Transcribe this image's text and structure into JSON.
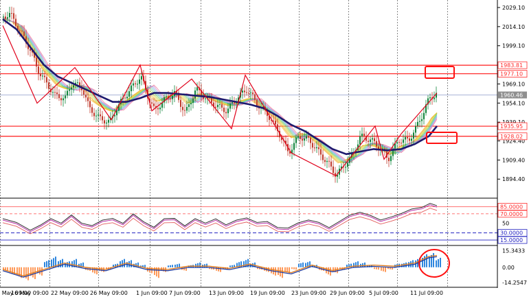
{
  "main_axis": {
    "min": 1880,
    "max": 2035,
    "ticks": [
      "2029.10",
      "2014.10",
      "1999.10",
      "1969.10",
      "1954.10",
      "1939.10",
      "1924.40",
      "1909.40",
      "1894.40"
    ],
    "tick_values": [
      2029.1,
      2014.1,
      1999.1,
      1969.1,
      1954.1,
      1939.1,
      1924.4,
      1909.4,
      1894.4
    ]
  },
  "price_labels": [
    {
      "text": "1983.81",
      "value": 1983.81,
      "color": "#ff2a2a"
    },
    {
      "text": "1977.10",
      "value": 1977.1,
      "color": "#ff2a2a"
    },
    {
      "text": "1960.46",
      "value": 1960.46,
      "color": "#ffffff",
      "bg": "#8f8f8f"
    },
    {
      "text": "1935.95",
      "value": 1935.95,
      "color": "#ff2a2a"
    },
    {
      "text": "1928.02",
      "value": 1928.02,
      "color": "#ff2a2a"
    }
  ],
  "levels": [
    1983.81,
    1977.1,
    1935.95,
    1928.02
  ],
  "current_price": 1960.46,
  "osc_axis": {
    "min": 5,
    "max": 100,
    "ticks": [
      {
        "text": "85.0000",
        "value": 85,
        "style": "red"
      },
      {
        "text": "70.0000",
        "value": 70,
        "style": "red"
      },
      {
        "text": "50",
        "value": 50,
        "style": "plain"
      },
      {
        "text": "30.0000",
        "value": 30,
        "style": "blue"
      },
      {
        "text": "15.0000",
        "value": 15,
        "style": "blue"
      }
    ]
  },
  "macd_axis": {
    "min": -18,
    "max": 19,
    "ticks": [
      {
        "text": "15.3433",
        "value": 15.3433
      },
      {
        "text": "0.00",
        "value": 0
      },
      {
        "text": "-14.2547",
        "value": -14.2547
      }
    ]
  },
  "dates": [
    "10 May 09:00",
    "16 May 09:00",
    "22 May 09:00",
    "26 May 09:00",
    "1 Jun 09:00",
    "7 Jun 09:00",
    "13 Jun 09:00",
    "19 Jun 09:00",
    "23 Jun 09:00",
    "29 Jun 09:00",
    "5 Jul 09:00",
    "11 Jul 09:00"
  ],
  "price_path": [
    [
      0,
      2022
    ],
    [
      10,
      2024
    ],
    [
      25,
      2010
    ],
    [
      40,
      1995
    ],
    [
      50,
      1980
    ],
    [
      65,
      1968
    ],
    [
      75,
      1960
    ],
    [
      90,
      1958
    ],
    [
      100,
      1970
    ],
    [
      115,
      1966
    ],
    [
      125,
      1950
    ],
    [
      140,
      1942
    ],
    [
      155,
      1939
    ],
    [
      165,
      1950
    ],
    [
      175,
      1958
    ],
    [
      185,
      1965
    ],
    [
      200,
      1975
    ],
    [
      210,
      1960
    ],
    [
      220,
      1948
    ],
    [
      235,
      1957
    ],
    [
      250,
      1962
    ],
    [
      265,
      1946
    ],
    [
      280,
      1965
    ],
    [
      295,
      1958
    ],
    [
      310,
      1952
    ],
    [
      325,
      1948
    ],
    [
      340,
      1958
    ],
    [
      355,
      1965
    ],
    [
      370,
      1953
    ],
    [
      385,
      1945
    ],
    [
      400,
      1932
    ],
    [
      415,
      1915
    ],
    [
      430,
      1928
    ],
    [
      445,
      1925
    ],
    [
      460,
      1915
    ],
    [
      475,
      1905
    ],
    [
      485,
      1897
    ],
    [
      495,
      1905
    ],
    [
      505,
      1910
    ],
    [
      520,
      1928
    ],
    [
      535,
      1925
    ],
    [
      550,
      1918
    ],
    [
      560,
      1910
    ],
    [
      575,
      1925
    ],
    [
      590,
      1925
    ],
    [
      600,
      1934
    ],
    [
      610,
      1945
    ],
    [
      620,
      1958
    ],
    [
      632,
      1962
    ]
  ],
  "ma_path": [
    [
      0,
      2020
    ],
    [
      20,
      2012
    ],
    [
      40,
      1998
    ],
    [
      60,
      1984
    ],
    [
      80,
      1975
    ],
    [
      100,
      1970
    ],
    [
      120,
      1965
    ],
    [
      140,
      1960
    ],
    [
      160,
      1955
    ],
    [
      180,
      1955
    ],
    [
      200,
      1958
    ],
    [
      220,
      1962
    ],
    [
      240,
      1962
    ],
    [
      260,
      1961
    ],
    [
      280,
      1960
    ],
    [
      300,
      1959
    ],
    [
      320,
      1957
    ],
    [
      340,
      1955
    ],
    [
      360,
      1953
    ],
    [
      380,
      1950
    ],
    [
      400,
      1944
    ],
    [
      420,
      1937
    ],
    [
      440,
      1932
    ],
    [
      460,
      1925
    ],
    [
      480,
      1918
    ],
    [
      500,
      1914
    ],
    [
      520,
      1916
    ],
    [
      540,
      1918
    ],
    [
      560,
      1917
    ],
    [
      580,
      1918
    ],
    [
      600,
      1922
    ],
    [
      620,
      1928
    ],
    [
      632,
      1936
    ]
  ],
  "zigzag": [
    [
      0,
      2015
    ],
    [
      50,
      1954
    ],
    [
      105,
      1982
    ],
    [
      158,
      1941
    ],
    [
      200,
      1984
    ],
    [
      217,
      1948
    ],
    [
      275,
      1973
    ],
    [
      333,
      1934
    ],
    [
      353,
      1976
    ],
    [
      420,
      1915
    ],
    [
      485,
      1897
    ],
    [
      542,
      1936
    ],
    [
      555,
      1910
    ],
    [
      580,
      1930
    ],
    [
      632,
      1962
    ]
  ],
  "osc_series": [
    [
      0,
      60
    ],
    [
      20,
      50
    ],
    [
      40,
      35
    ],
    [
      55,
      45
    ],
    [
      70,
      62
    ],
    [
      85,
      50
    ],
    [
      100,
      66
    ],
    [
      115,
      52
    ],
    [
      130,
      45
    ],
    [
      145,
      55
    ],
    [
      160,
      62
    ],
    [
      175,
      50
    ],
    [
      190,
      68
    ],
    [
      205,
      55
    ],
    [
      220,
      42
    ],
    [
      235,
      58
    ],
    [
      250,
      62
    ],
    [
      265,
      45
    ],
    [
      280,
      58
    ],
    [
      295,
      52
    ],
    [
      310,
      60
    ],
    [
      325,
      45
    ],
    [
      340,
      58
    ],
    [
      355,
      62
    ],
    [
      370,
      50
    ],
    [
      385,
      55
    ],
    [
      400,
      42
    ],
    [
      415,
      38
    ],
    [
      430,
      52
    ],
    [
      445,
      58
    ],
    [
      460,
      50
    ],
    [
      475,
      42
    ],
    [
      490,
      55
    ],
    [
      505,
      65
    ],
    [
      520,
      74
    ],
    [
      535,
      68
    ],
    [
      550,
      55
    ],
    [
      565,
      64
    ],
    [
      580,
      72
    ],
    [
      595,
      78
    ],
    [
      610,
      84
    ],
    [
      622,
      90
    ],
    [
      632,
      86
    ]
  ],
  "macd_hist": [
    [
      0,
      -3
    ],
    [
      10,
      -6
    ],
    [
      20,
      -9
    ],
    [
      30,
      -11
    ],
    [
      40,
      -10
    ],
    [
      50,
      -7
    ],
    [
      60,
      6
    ],
    [
      70,
      9
    ],
    [
      80,
      7
    ],
    [
      90,
      5
    ],
    [
      100,
      7
    ],
    [
      110,
      4
    ],
    [
      120,
      -3
    ],
    [
      130,
      -6
    ],
    [
      140,
      -4
    ],
    [
      150,
      -2
    ],
    [
      160,
      3
    ],
    [
      170,
      7
    ],
    [
      180,
      6
    ],
    [
      190,
      4
    ],
    [
      200,
      2
    ],
    [
      210,
      -5
    ],
    [
      220,
      -9
    ],
    [
      230,
      -4
    ],
    [
      240,
      2
    ],
    [
      250,
      3
    ],
    [
      260,
      -3
    ],
    [
      270,
      2
    ],
    [
      280,
      4
    ],
    [
      290,
      3
    ],
    [
      300,
      -2
    ],
    [
      310,
      -4
    ],
    [
      320,
      -2
    ],
    [
      330,
      2
    ],
    [
      340,
      5
    ],
    [
      350,
      7
    ],
    [
      360,
      4
    ],
    [
      370,
      -2
    ],
    [
      380,
      -4
    ],
    [
      390,
      -7
    ],
    [
      400,
      -9
    ],
    [
      410,
      -5
    ],
    [
      420,
      -2
    ],
    [
      430,
      4
    ],
    [
      440,
      5
    ],
    [
      450,
      2
    ],
    [
      460,
      -3
    ],
    [
      470,
      -7
    ],
    [
      480,
      -5
    ],
    [
      490,
      -2
    ],
    [
      500,
      3
    ],
    [
      510,
      5
    ],
    [
      520,
      4
    ],
    [
      530,
      2
    ],
    [
      540,
      -2
    ],
    [
      550,
      -4
    ],
    [
      560,
      -2
    ],
    [
      570,
      3
    ],
    [
      580,
      4
    ],
    [
      590,
      6
    ],
    [
      600,
      8
    ],
    [
      610,
      11
    ],
    [
      620,
      12
    ],
    [
      630,
      8
    ]
  ],
  "macd_signal": [
    [
      0,
      -2
    ],
    [
      30,
      -8
    ],
    [
      60,
      -2
    ],
    [
      90,
      4
    ],
    [
      120,
      0
    ],
    [
      150,
      -2
    ],
    [
      180,
      4
    ],
    [
      210,
      -1
    ],
    [
      240,
      -2
    ],
    [
      270,
      1
    ],
    [
      300,
      1
    ],
    [
      330,
      -1
    ],
    [
      360,
      3
    ],
    [
      390,
      -2
    ],
    [
      420,
      -5
    ],
    [
      450,
      2
    ],
    [
      480,
      -3
    ],
    [
      510,
      1
    ],
    [
      540,
      2
    ],
    [
      570,
      1
    ],
    [
      600,
      4
    ],
    [
      620,
      10
    ],
    [
      632,
      11
    ]
  ],
  "colors": {
    "up": "#10843a",
    "down": "#c0392b",
    "level": "#ff1a1a",
    "ma": "#1e1a6e",
    "zigzag": "#e0001a",
    "osc_fast": "#1a1a1a",
    "osc_slow": "#b01aa0",
    "osc_red": "#e25c5c",
    "hist_pos": "#2e86de",
    "hist_neg": "#ff9a5a",
    "signal": "#e07b1a",
    "macd_line": "#1e3a9e"
  }
}
